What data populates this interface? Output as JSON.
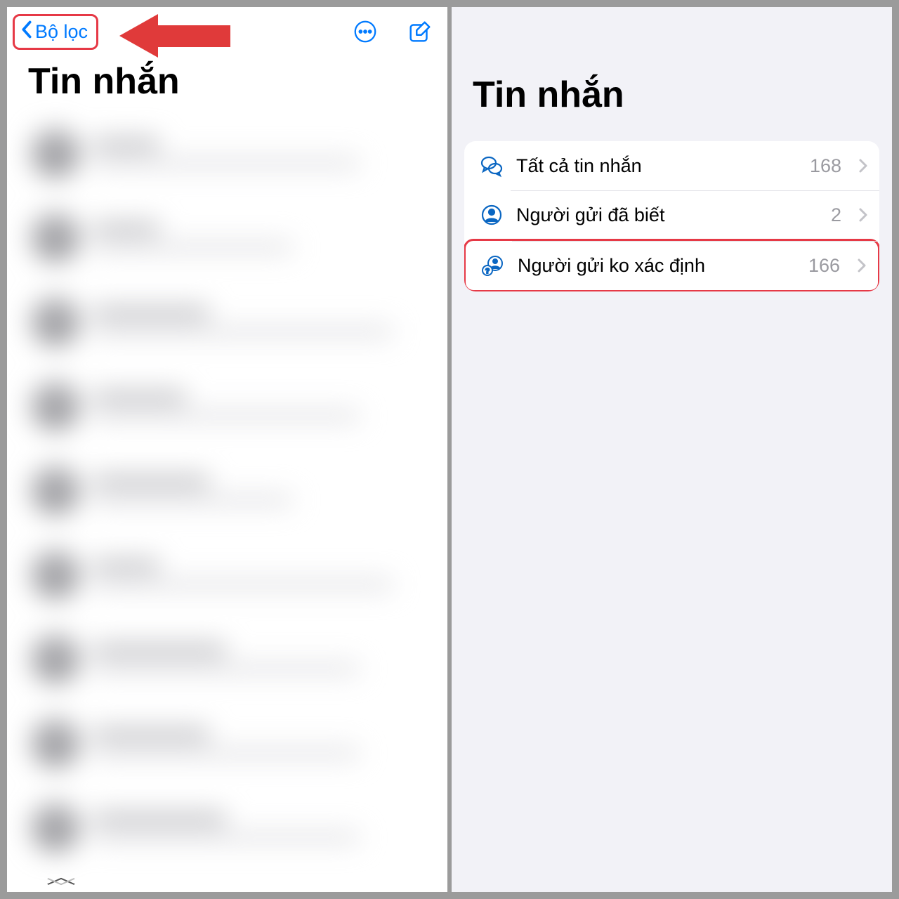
{
  "left": {
    "back_label": "Bộ lọc",
    "title": "Tin nhắn"
  },
  "right": {
    "title": "Tin nhắn",
    "filters": [
      {
        "label": "Tất cả tin nhắn",
        "count": "168"
      },
      {
        "label": "Người gửi đã biết",
        "count": "2"
      },
      {
        "label": "Người gửi ko xác định",
        "count": "166"
      }
    ]
  },
  "colors": {
    "accent": "#007aff",
    "highlight": "#e63946"
  }
}
